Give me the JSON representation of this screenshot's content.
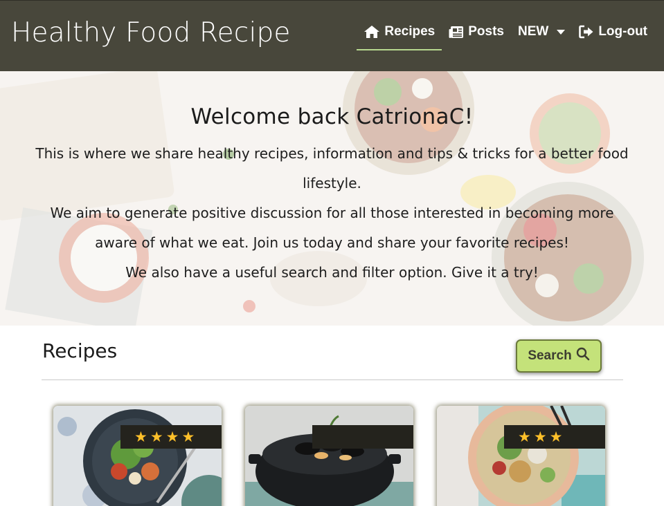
{
  "brand": "Healthy Food Recipe",
  "nav": {
    "recipes_label": "Recipes",
    "posts_label": "Posts",
    "new_label": "NEW",
    "logout_label": "Log-out"
  },
  "hero": {
    "title": "Welcome back CatrionaC!",
    "line1": "This is where we share healthy recipes, information and tips & tricks for a better food lifestyle.",
    "line2": "We aim to generate positive discussion for all those interested in becoming more aware of what we eat. Join us today and share your favorite recipes!",
    "line3": "We also have a useful search and filter option. Give it a try!"
  },
  "recipes": {
    "title": "Recipes",
    "search_label": "Search",
    "cards": [
      {
        "rating": 4,
        "image": "salad-plate-photo"
      },
      {
        "rating": 0,
        "image": "mussels-pot-photo"
      },
      {
        "rating": 3,
        "image": "chickpea-salad-bowl-photo"
      }
    ]
  },
  "colors": {
    "navbar": "#48473b",
    "accent": "#c4e27a",
    "active_underline": "#b7d98f",
    "rating_bar": "#24231d",
    "star": "#ffc02a"
  }
}
